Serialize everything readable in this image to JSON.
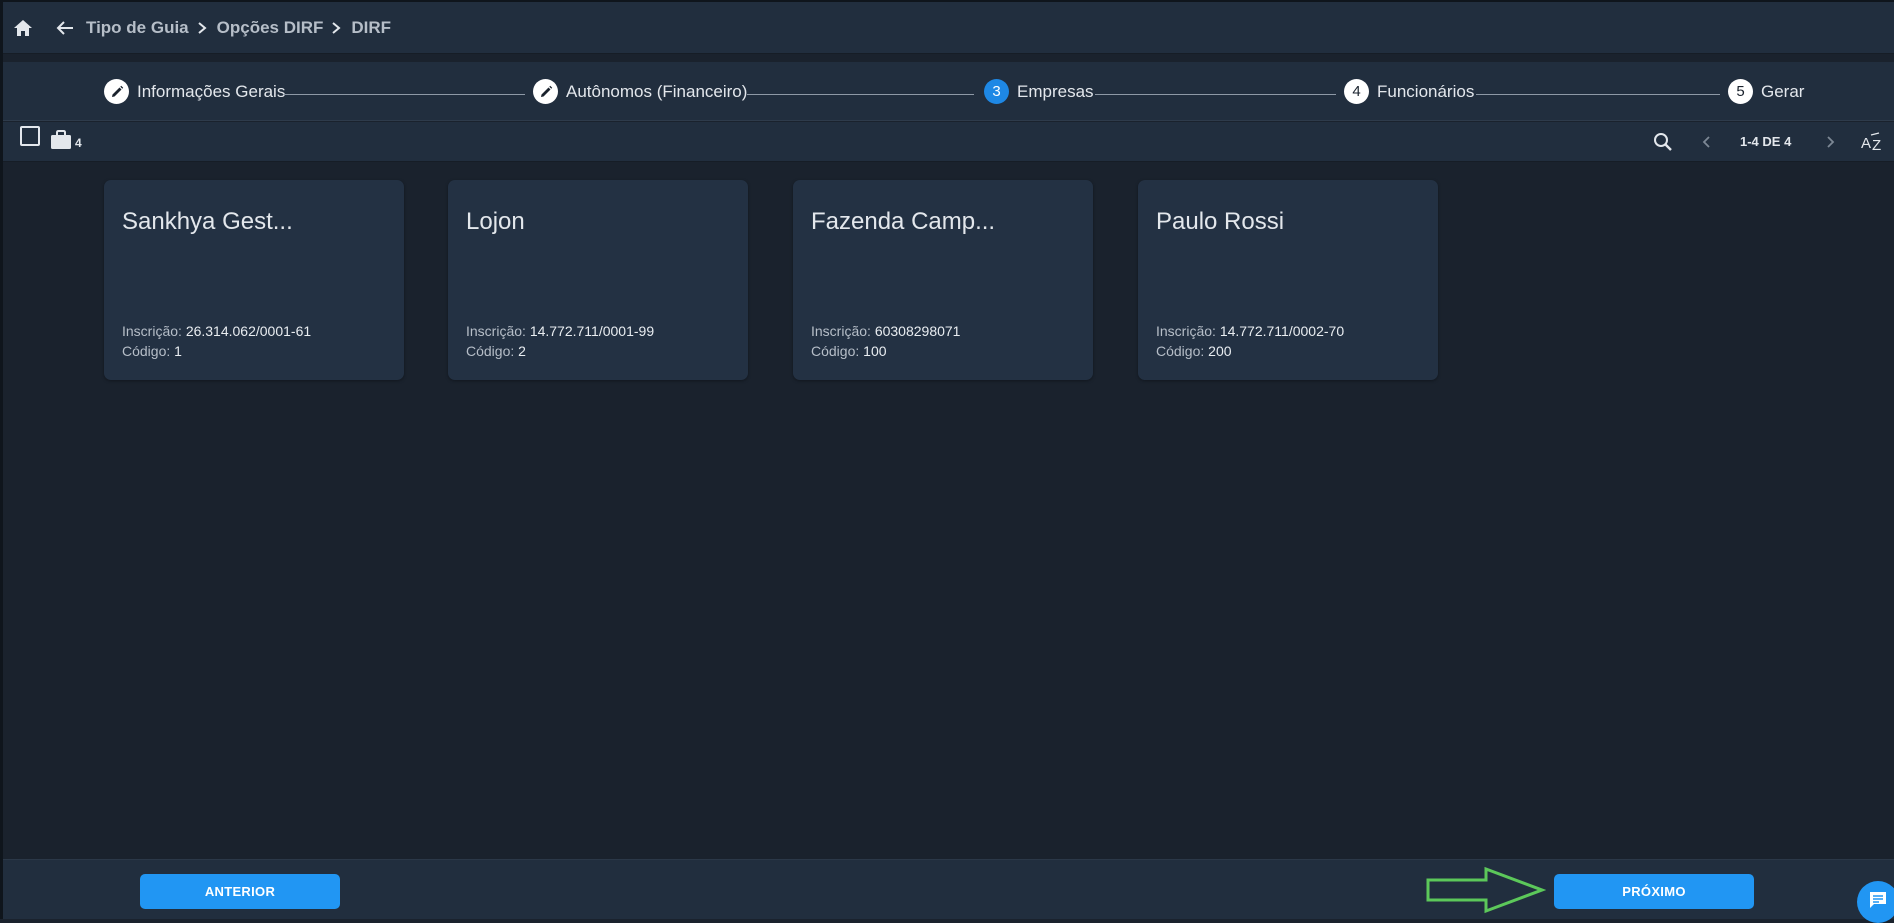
{
  "breadcrumb": {
    "items": [
      "Tipo de Guia",
      "Opções DIRF",
      "DIRF"
    ]
  },
  "stepper": {
    "steps": [
      {
        "label": "Informações Gerais",
        "marker": ""
      },
      {
        "label": "Autônomos (Financeiro)",
        "marker": ""
      },
      {
        "label": "Empresas",
        "marker": "3"
      },
      {
        "label": "Funcionários",
        "marker": "4"
      },
      {
        "label": "Gerar",
        "marker": "5"
      }
    ],
    "active_index": 2
  },
  "toolbar": {
    "count": "4",
    "pager": "1-4 DE 4",
    "sort_icon": "az-sort-icon"
  },
  "cards": [
    {
      "title": "Sankhya Gest...",
      "insc_label": "Inscrição:",
      "insc_value": "26.314.062/0001-61",
      "cod_label": "Código:",
      "cod_value": "1"
    },
    {
      "title": "Lojon",
      "insc_label": "Inscrição:",
      "insc_value": "14.772.711/0001-99",
      "cod_label": "Código:",
      "cod_value": "2"
    },
    {
      "title": "Fazenda Camp...",
      "insc_label": "Inscrição:",
      "insc_value": "60308298071",
      "cod_label": "Código:",
      "cod_value": "100"
    },
    {
      "title": "Paulo Rossi",
      "insc_label": "Inscrição:",
      "insc_value": "14.772.711/0002-70",
      "cod_label": "Código:",
      "cod_value": "200"
    }
  ],
  "footer": {
    "prev_label": "ANTERIOR",
    "next_label": "PRÓXIMO"
  },
  "colors": {
    "accent": "#2196f3",
    "annotation_arrow": "#5cc85a",
    "background": "#1a222d",
    "surface": "#212e3e",
    "card": "#233143"
  }
}
